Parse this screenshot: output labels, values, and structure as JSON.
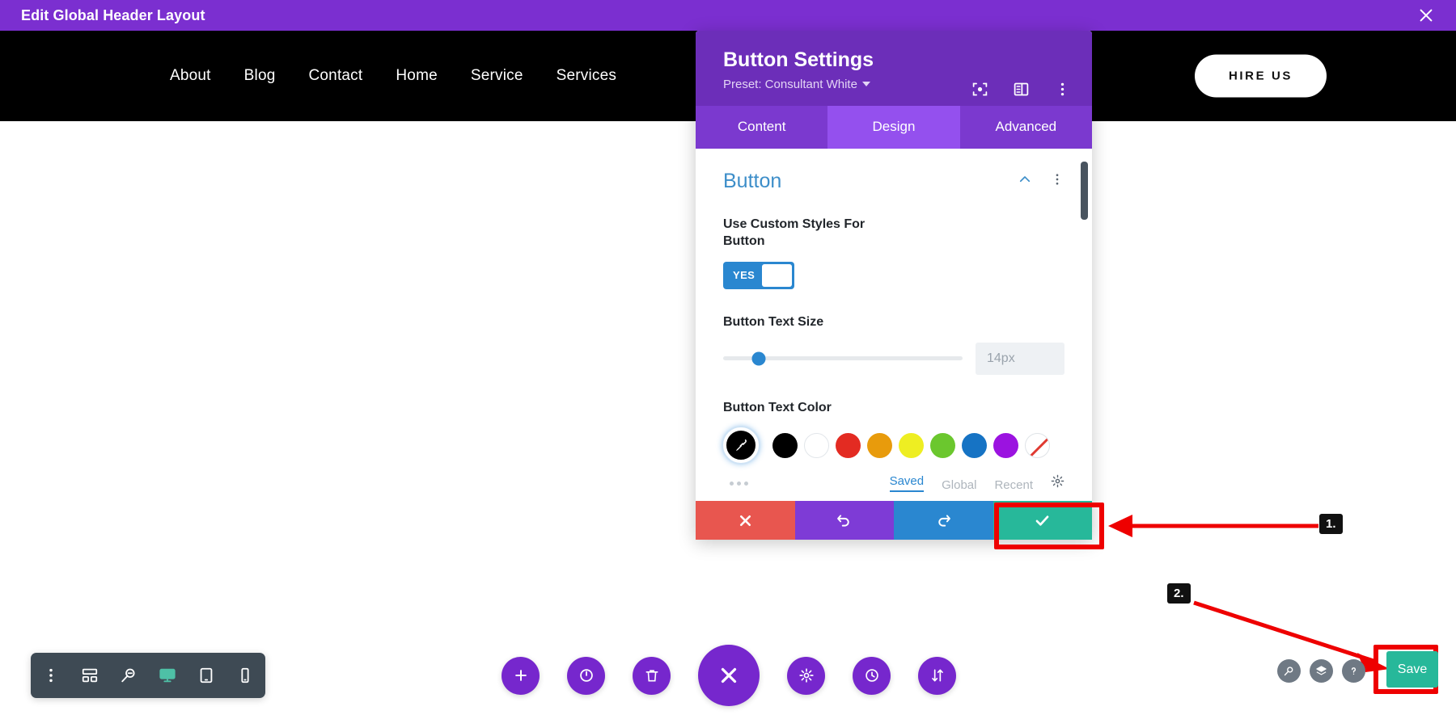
{
  "admin_bar": {
    "title": "Edit Global Header Layout",
    "close_icon": "close-icon"
  },
  "site_header": {
    "nav_items": [
      {
        "label": "About"
      },
      {
        "label": "Blog"
      },
      {
        "label": "Contact"
      },
      {
        "label": "Home"
      },
      {
        "label": "Service"
      },
      {
        "label": "Services"
      }
    ],
    "cta_label": "HIRE US"
  },
  "settings_modal": {
    "title": "Button Settings",
    "preset_label": "Preset: Consultant White",
    "header_icons": [
      {
        "name": "fullscreen-icon"
      },
      {
        "name": "layout-panel-icon"
      },
      {
        "name": "more-vertical-icon"
      }
    ],
    "tabs": [
      {
        "label": "Content",
        "active": false
      },
      {
        "label": "Design",
        "active": true
      },
      {
        "label": "Advanced",
        "active": false
      }
    ],
    "section": {
      "title": "Button",
      "collapse_icon": "chevron-up-icon",
      "menu_icon": "more-vertical-icon"
    },
    "fields": {
      "custom_styles": {
        "label": "Use Custom Styles For Button",
        "toggle_value": "YES"
      },
      "text_size": {
        "label": "Button Text Size",
        "value": "14px",
        "slider_percent": 15
      },
      "text_color": {
        "label": "Button Text Color",
        "active_swatch": "eyedropper-icon",
        "swatches": [
          {
            "name": "black",
            "hex": "#000000"
          },
          {
            "name": "white",
            "hex": "#ffffff"
          },
          {
            "name": "red",
            "hex": "#e32b22"
          },
          {
            "name": "orange",
            "hex": "#e89b0c"
          },
          {
            "name": "yellow",
            "hex": "#eeee22"
          },
          {
            "name": "green",
            "hex": "#6bc72e"
          },
          {
            "name": "blue",
            "hex": "#1673c4"
          },
          {
            "name": "purple",
            "hex": "#9b13e0"
          },
          {
            "name": "none",
            "hex": "transparent"
          }
        ],
        "source_tabs": [
          {
            "label": "Saved",
            "active": true
          },
          {
            "label": "Global",
            "active": false
          },
          {
            "label": "Recent",
            "active": false
          }
        ],
        "gear_icon": "gear-icon",
        "more_icon": "more-horizontal-icon"
      }
    },
    "footer_buttons": [
      {
        "name": "cancel",
        "icon": "close-icon",
        "color": "#e8564f"
      },
      {
        "name": "undo",
        "icon": "undo-icon",
        "color": "#7e3bd6"
      },
      {
        "name": "redo",
        "icon": "redo-icon",
        "color": "#2a87d0"
      },
      {
        "name": "save",
        "icon": "check-icon",
        "color": "#27b89a"
      }
    ]
  },
  "annotations": [
    {
      "label": "1."
    },
    {
      "label": "2."
    }
  ],
  "bottom_left_toolbar": {
    "items": [
      {
        "name": "more-vertical-icon"
      },
      {
        "name": "wireframe-icon"
      },
      {
        "name": "zoom-out-icon"
      },
      {
        "name": "desktop-icon",
        "active": true
      },
      {
        "name": "tablet-icon"
      },
      {
        "name": "phone-icon"
      }
    ],
    "active_color": "#4ec0a6"
  },
  "bottom_center_toolbar": {
    "items": [
      {
        "name": "add-icon"
      },
      {
        "name": "power-icon"
      },
      {
        "name": "trash-icon"
      },
      {
        "name": "close-icon",
        "primary": true
      },
      {
        "name": "gear-icon"
      },
      {
        "name": "history-icon"
      },
      {
        "name": "sort-icon"
      }
    ],
    "color": "#7627cd"
  },
  "bottom_right": {
    "icons": [
      {
        "name": "search-icon"
      },
      {
        "name": "layers-icon"
      },
      {
        "name": "help-icon"
      }
    ],
    "save_label": "Save",
    "save_color": "#27b89a"
  },
  "colors": {
    "admin_purple": "#7b2fd0",
    "modal_purple": "#6c2eb9",
    "tab_active_purple": "#9450ee",
    "accent_blue": "#2a87d0",
    "section_blue": "#3d8ec9",
    "highlight_red": "#ee0000"
  }
}
